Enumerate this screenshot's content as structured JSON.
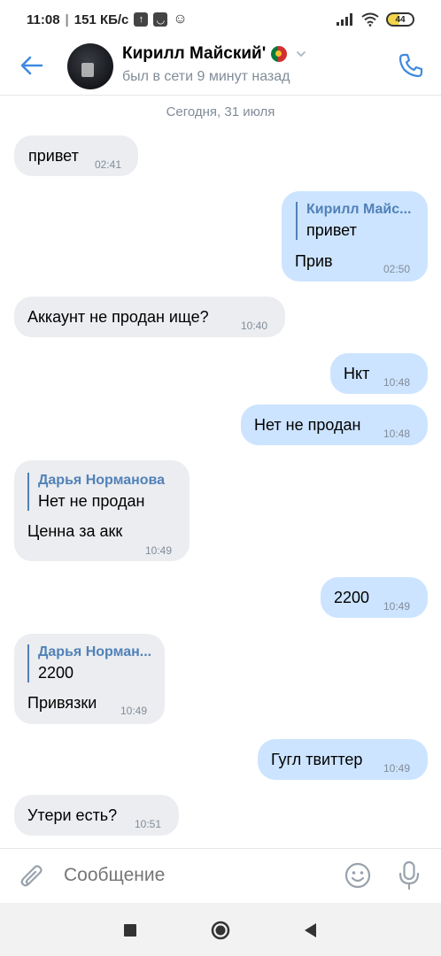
{
  "status_bar": {
    "time": "11:08",
    "speed": "151 КБ/с",
    "battery": "44"
  },
  "header": {
    "contact_name": "Кирилл Майский'",
    "status": "был в сети 9 минут назад",
    "accent_color": "#3f8ae0",
    "icons": [
      "back-arrow-icon",
      "chevron-down-icon",
      "phone-icon"
    ]
  },
  "date_divider": "Сегодня, 31 июля",
  "messages": [
    {
      "dir": "in",
      "text": "привет",
      "time": "02:41"
    },
    {
      "dir": "out",
      "reply_name": "Кирилл Майс...",
      "reply_text": "привет",
      "text": "Прив",
      "time": "02:50"
    },
    {
      "dir": "in",
      "text": "Аккаунт не продан ище?",
      "time": "10:40"
    },
    {
      "dir": "out",
      "text": "Нкт",
      "time": "10:48"
    },
    {
      "dir": "out",
      "text": "Нет не продан",
      "time": "10:48"
    },
    {
      "dir": "in",
      "reply_name": "Дарья Норманова",
      "reply_text": "Нет не продан",
      "text": "Ценна за акк",
      "time": "10:49"
    },
    {
      "dir": "out",
      "text": "2200",
      "time": "10:49"
    },
    {
      "dir": "in",
      "reply_name": "Дарья Норман...",
      "reply_text": "2200",
      "text": "Привязки",
      "time": "10:49"
    },
    {
      "dir": "out",
      "text": "Гугл твиттер",
      "time": "10:49"
    },
    {
      "dir": "in",
      "text": "Утери есть?",
      "time": "10:51"
    }
  ],
  "composer": {
    "placeholder": "Сообщение",
    "icons": [
      "paperclip-icon",
      "emoji-icon",
      "microphone-icon"
    ]
  },
  "colors": {
    "incoming_bubble": "#ebedf0",
    "outgoing_bubble": "#cce4ff",
    "reply_accent": "#5181b8",
    "secondary_text": "#818c99"
  }
}
